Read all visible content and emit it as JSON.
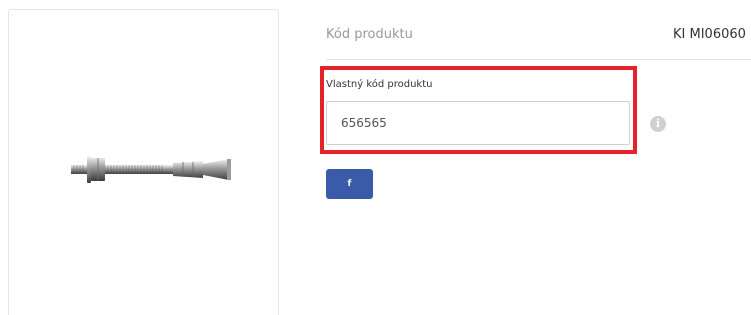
{
  "product_code": {
    "label": "Kód produktu",
    "value": "KI MI06060"
  },
  "custom_code": {
    "label": "Vlastný kód produktu",
    "value": "656565"
  },
  "info_icon": {
    "icon": "info-icon",
    "glyph": "i"
  },
  "share": {
    "facebook_glyph": "f",
    "color": "#3b5ba9"
  },
  "highlight_color": "#e3222b"
}
